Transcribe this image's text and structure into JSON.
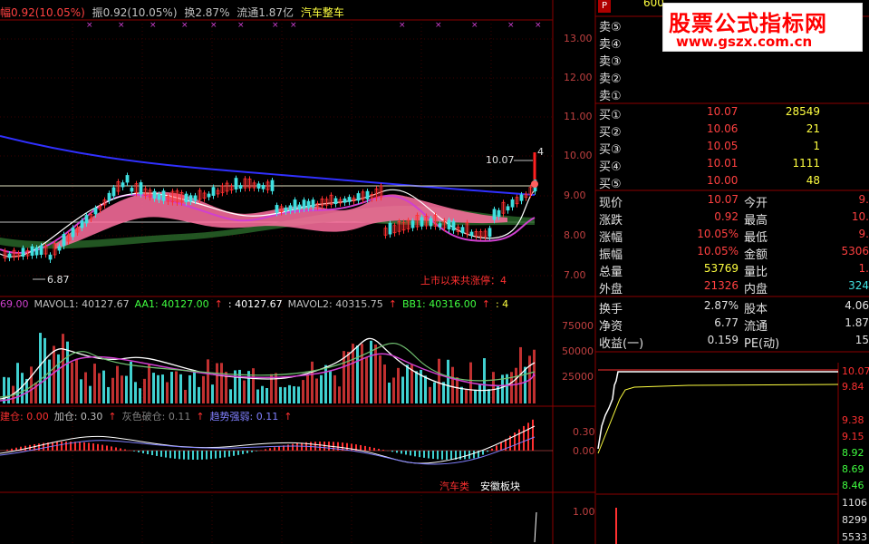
{
  "header": {
    "fu": "幅0.92(10.05%)",
    "zhen": "振0.92(10.05%)",
    "huan": "换2.87%",
    "liutong": "流通1.87亿",
    "sector": "汽车整车"
  },
  "price_axis": [
    "13.00",
    "12.00",
    "11.00",
    "10.00",
    "9.00",
    "8.00",
    "7.00"
  ],
  "annotations": {
    "high_price": "10.07",
    "high_mark": "4",
    "low_price": "6.87",
    "limit_up_text": "上市以来共涨停：4"
  },
  "vol_panel": {
    "legend": [
      {
        "text": "69.00",
        "color": "#d040d0"
      },
      {
        "text": "MAVOL1: 40127.67",
        "color": "#c0c0c0"
      },
      {
        "text": "AA1: 40127.00",
        "color": "#40ff40"
      },
      {
        "text": "↑",
        "color": "#ff3030"
      },
      {
        "text": ": 40127.67",
        "color": "#ffffff"
      },
      {
        "text": "MAVOL2: 40315.75",
        "color": "#c0c0c0"
      },
      {
        "text": "↑",
        "color": "#ff3030"
      },
      {
        "text": "BB1: 40316.00",
        "color": "#40ff40"
      },
      {
        "text": "↑",
        "color": "#ff3030"
      },
      {
        "text": ": 4",
        "color": "#ffff40"
      }
    ],
    "axis": [
      "75000",
      "50000",
      "25000"
    ]
  },
  "macd_panel": {
    "legend": [
      {
        "text": "建仓: 0.00",
        "color": "#ff3030"
      },
      {
        "text": "加仓: 0.30",
        "color": "#c0c0c0"
      },
      {
        "text": "↑",
        "color": "#ff3030"
      },
      {
        "text": "灰色破仓: 0.11",
        "color": "#808080"
      },
      {
        "text": "↑",
        "color": "#ff3030"
      },
      {
        "text": "趋势强弱: 0.11",
        "color": "#8080ff"
      },
      {
        "text": "↑",
        "color": "#ff3030"
      }
    ],
    "axis": [
      "0.30",
      "0.00"
    ],
    "tags": [
      "汽车类",
      "安徽板块"
    ]
  },
  "bottom_panel": {
    "axis": [
      "1.00"
    ]
  },
  "order_book": {
    "sell": [
      "卖⑤",
      "卖④",
      "卖③",
      "卖②",
      "卖①"
    ],
    "buy": [
      {
        "label": "买①",
        "price": "10.07",
        "vol": "28549"
      },
      {
        "label": "买②",
        "price": "10.06",
        "vol": "21"
      },
      {
        "label": "买③",
        "price": "10.05",
        "vol": "1"
      },
      {
        "label": "买④",
        "price": "10.01",
        "vol": "1111"
      },
      {
        "label": "买⑤",
        "price": "10.00",
        "vol": "48"
      }
    ]
  },
  "quote": [
    {
      "l1": "现价",
      "v1": "10.07",
      "l2": "今开",
      "v2": "9."
    },
    {
      "l1": "涨跌",
      "v1": "0.92",
      "l2": "最高",
      "v2": "10."
    },
    {
      "l1": "涨幅",
      "v1": "10.05%",
      "l2": "最低",
      "v2": "9."
    },
    {
      "l1": "振幅",
      "v1": "10.05%",
      "l2": "金额",
      "v2": "5306"
    },
    {
      "l1": "总量",
      "v1": "53769",
      "l2": "量比",
      "v2": "1."
    },
    {
      "l1": "外盘",
      "v1": "21326",
      "l2": "内盘",
      "v2": "324"
    }
  ],
  "quote2": [
    {
      "l1": "换手",
      "v1": "2.87%",
      "l2": "股本",
      "v2": "4.06"
    },
    {
      "l1": "净资",
      "v1": "6.77",
      "l2": "流通",
      "v2": "1.87"
    },
    {
      "l1": "收益(一)",
      "v1": "0.159",
      "l2": "PE(动)",
      "v2": "15"
    }
  ],
  "mini_chart": {
    "axis": [
      "10.07",
      "9.84",
      "9.38",
      "9.15",
      "8.92",
      "8.69",
      "8.46"
    ],
    "vol_axis": [
      "1106",
      "8299",
      "5533"
    ]
  },
  "stock_code": "600",
  "panel_icon": "P",
  "watermark": {
    "title": "股票公式指标网",
    "url": "www.gszx.com.cn"
  }
}
